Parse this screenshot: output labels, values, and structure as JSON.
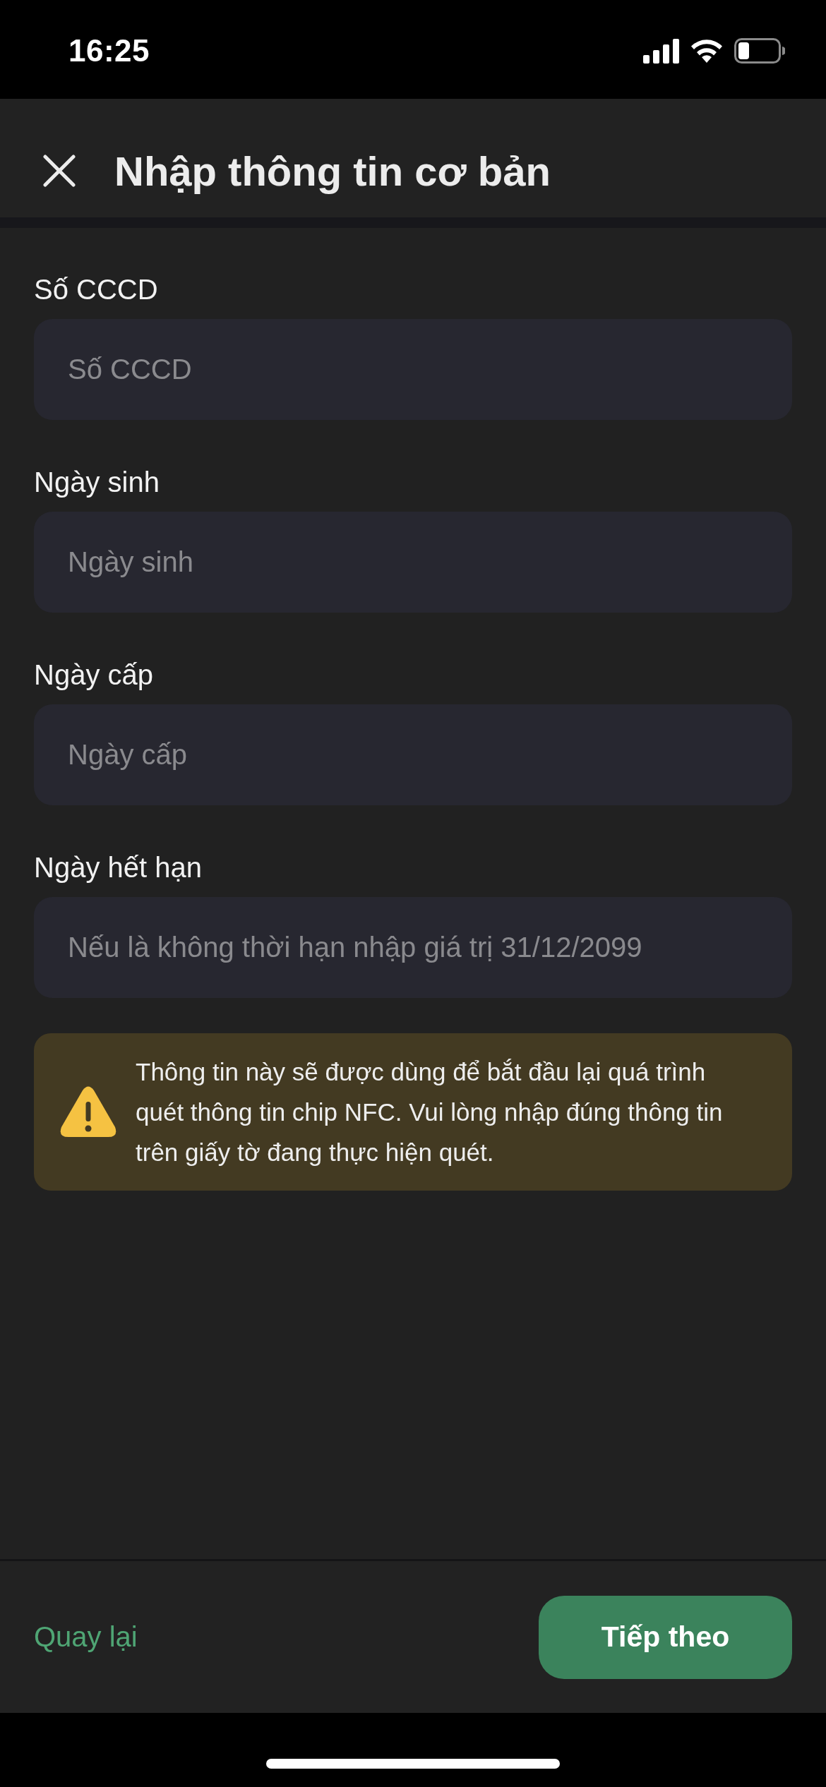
{
  "status_bar": {
    "time": "16:25"
  },
  "header": {
    "title": "Nhập thông tin cơ bản"
  },
  "fields": [
    {
      "label": "Số CCCD",
      "placeholder": "Số CCCD"
    },
    {
      "label": "Ngày sinh",
      "placeholder": "Ngày sinh"
    },
    {
      "label": "Ngày cấp",
      "placeholder": "Ngày cấp"
    },
    {
      "label": "Ngày hết hạn",
      "placeholder": "Nếu là không thời hạn nhập giá trị 31/12/2099"
    }
  ],
  "notice": {
    "text": "Thông tin này sẽ được dùng để bắt đầu lại quá trình quét thông tin chip NFC. Vui lòng nhập đúng thông tin trên giấy tờ đang thực hiện quét."
  },
  "footer": {
    "back": "Quay lại",
    "next": "Tiếp theo"
  }
}
